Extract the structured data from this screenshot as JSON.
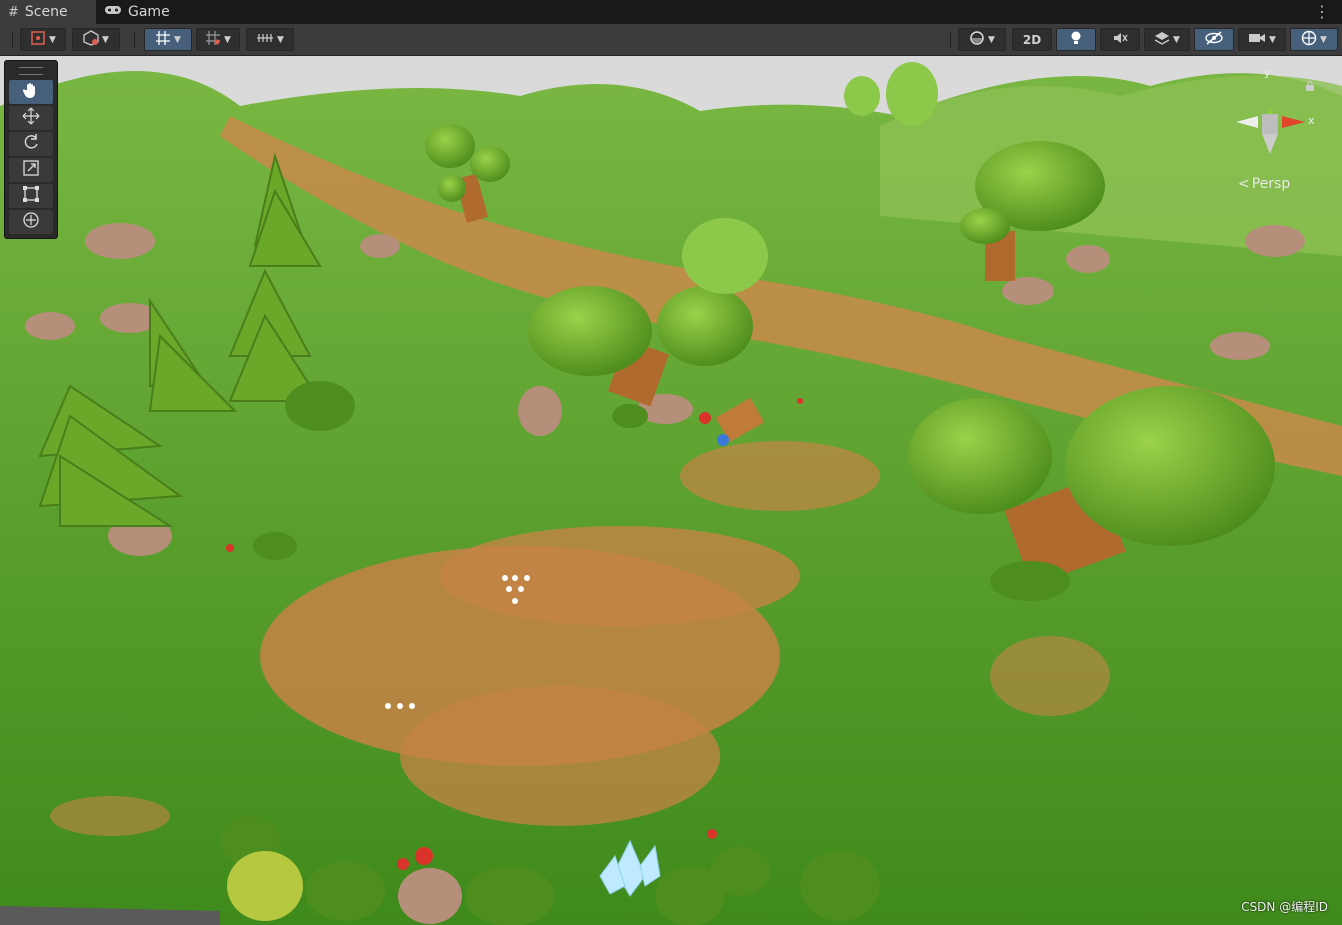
{
  "tabs": [
    {
      "label": "Scene",
      "icon": "grid-icon"
    },
    {
      "label": "Game",
      "icon": "gamepad-icon"
    }
  ],
  "toolbar": {
    "mode_2d_label": "2D"
  },
  "tools": [
    "hand-tool",
    "move-tool",
    "rotate-tool",
    "scale-tool",
    "rect-tool",
    "transform-tool"
  ],
  "gizmo": {
    "projection_label": "Persp",
    "axis_y": "y",
    "axis_x": "x"
  },
  "watermark": "CSDN @编程ID",
  "colors": {
    "accent": "#46607c",
    "grass": "#5a9a2a",
    "dirt": "#c98a4a",
    "gizmo_y": "#8bd43a",
    "gizmo_x": "#e0452b"
  }
}
